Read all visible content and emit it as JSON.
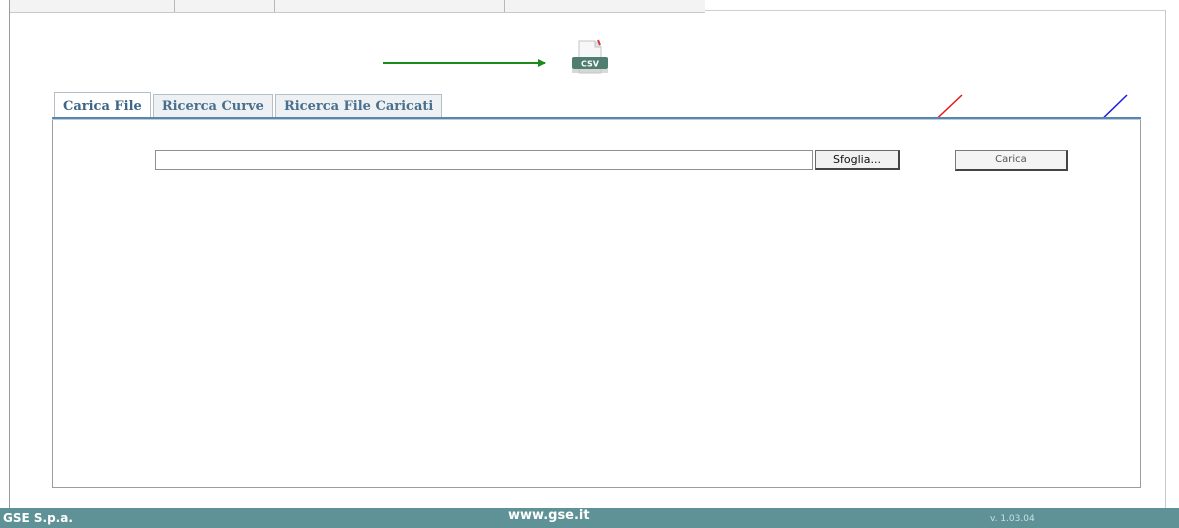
{
  "tabs": [
    {
      "label": "Carica File",
      "active": true
    },
    {
      "label": "Ricerca Curve",
      "active": false
    },
    {
      "label": "Ricerca File Caricati",
      "active": false
    }
  ],
  "csv_icon": {
    "icon": "csv-file-icon",
    "label": "CSV"
  },
  "upload_form": {
    "file_path_value": "",
    "browse_label": "Sfoglia...",
    "upload_label": "Carica"
  },
  "annotation_arrows": [
    {
      "color": "#1a8a1a",
      "target": "csv-file-icon"
    },
    {
      "color": "#e81818",
      "target": "browse-button"
    },
    {
      "color": "#1b1be0",
      "target": "upload-button"
    }
  ],
  "footer": {
    "company": "GSE S.p.a.",
    "website": "www.gse.it",
    "version": "v. 1.03.04"
  },
  "colors": {
    "footer_bg": "#5f9296",
    "tab_text": "#4a6f8d",
    "tab_underline": "#5b86ab"
  }
}
